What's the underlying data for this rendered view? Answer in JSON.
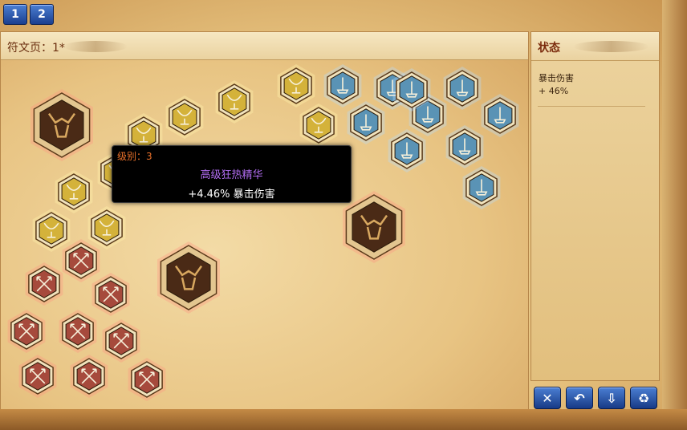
{
  "tabs": [
    {
      "label": "1"
    },
    {
      "label": "2"
    }
  ],
  "board": {
    "title": "符文页：1*"
  },
  "status": {
    "title": "状态",
    "stat_name": "暴击伤害",
    "stat_value": "+ 46%"
  },
  "tooltip": {
    "level": "级别：3",
    "name": "高级狂热精华",
    "effect": "+4.46% 暴击伤害"
  },
  "buttons": [
    {
      "icon": "close-icon",
      "glyph": "✕"
    },
    {
      "icon": "undo-icon",
      "glyph": "↶"
    },
    {
      "icon": "save-icon",
      "glyph": "⇩"
    },
    {
      "icon": "recycle-icon",
      "glyph": "♻"
    }
  ],
  "colors": {
    "accent_blue": "#2a55b0",
    "tooltip_level": "#e8702a",
    "tooltip_name": "#b06cf0",
    "rune_gold": "#d4b23a",
    "rune_blue": "#5a93b5",
    "rune_red": "#a64a3c",
    "quintessence": "#4a2a16"
  },
  "runes": {
    "gold": [
      {
        "icon": "chalice-icon"
      },
      {
        "icon": "chalice-icon"
      },
      {
        "icon": "chalice-icon"
      },
      {
        "icon": "chalice-icon"
      },
      {
        "icon": "chalice-icon"
      },
      {
        "icon": "chalice-icon"
      },
      {
        "icon": "chalice-icon"
      },
      {
        "icon": "chalice-icon"
      },
      {
        "icon": "chalice-icon"
      }
    ],
    "blue": [
      {
        "icon": "candle-icon"
      },
      {
        "icon": "candle-icon"
      },
      {
        "icon": "candle-icon"
      },
      {
        "icon": "candle-icon"
      },
      {
        "icon": "candle-icon"
      },
      {
        "icon": "candle-icon"
      },
      {
        "icon": "candle-icon"
      },
      {
        "icon": "candle-icon"
      },
      {
        "icon": "candle-icon"
      },
      {
        "icon": "candle-icon"
      }
    ],
    "red": [
      {
        "icon": "crossed-arrows-icon"
      },
      {
        "icon": "crossed-arrows-icon"
      },
      {
        "icon": "crossed-arrows-icon"
      },
      {
        "icon": "crossed-arrows-icon"
      },
      {
        "icon": "crossed-arrows-icon"
      },
      {
        "icon": "crossed-arrows-icon"
      },
      {
        "icon": "crossed-arrows-icon"
      },
      {
        "icon": "crossed-arrows-icon"
      },
      {
        "icon": "crossed-arrows-icon"
      }
    ],
    "quintessence": [
      {
        "icon": "dragon-icon"
      },
      {
        "icon": "dragon-icon"
      },
      {
        "icon": "dragon-icon"
      }
    ]
  }
}
